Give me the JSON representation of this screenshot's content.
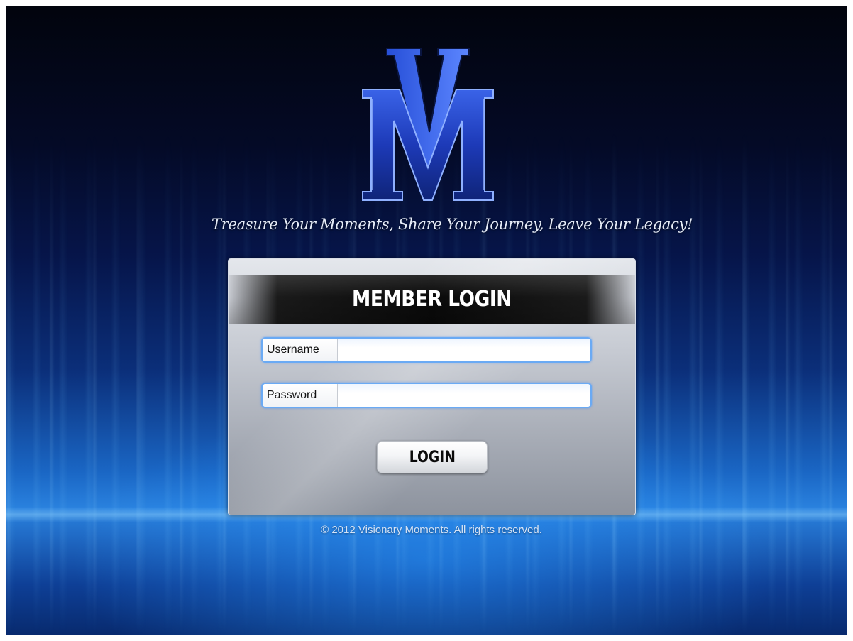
{
  "brand": {
    "logo_letters": "VM",
    "tagline": "Treasure Your Moments, Share Your Journey, Leave Your Legacy!"
  },
  "login": {
    "title": "MEMBER LOGIN",
    "username_label": "Username",
    "username_value": "",
    "password_label": "Password",
    "password_value": "",
    "button_label": "LOGIN"
  },
  "footer": {
    "copyright": "© 2012 Visionary Moments. All rights reserved."
  },
  "colors": {
    "background_top": "#02040d",
    "background_glow": "#2a82df",
    "field_focus_border": "#6aaaf4",
    "header_bar": "#0a0a0a"
  },
  "icons": {
    "logo": "vm-monogram-logo"
  }
}
